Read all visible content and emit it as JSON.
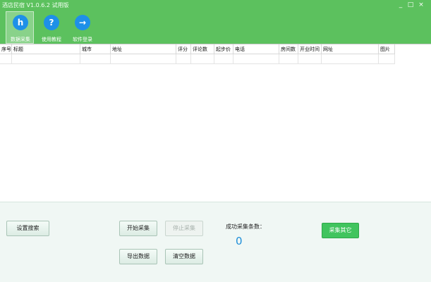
{
  "app": {
    "title": "酒店民宿 V1.0.6.2 试用版",
    "window_controls": {
      "minimize": "_",
      "maximize": "□",
      "close": "×"
    }
  },
  "toolbar": {
    "items": [
      {
        "label": "数据采集",
        "icon": "h",
        "icon_name": "h-logo-icon",
        "active": true
      },
      {
        "label": "使用教程",
        "icon": "?",
        "icon_name": "question-icon",
        "active": false
      },
      {
        "label": "软件登录",
        "icon": "→",
        "icon_name": "arrow-right-icon",
        "active": false
      }
    ]
  },
  "table": {
    "columns": [
      "序号",
      "标题",
      "城市",
      "地址",
      "评分",
      "评论数",
      "起步价",
      "电话",
      "房间数",
      "开业时间",
      "网址",
      "图片"
    ],
    "rows": []
  },
  "controls": {
    "settings_label": "设置搜索",
    "start_label": "开始采集",
    "stop_label": "停止采集",
    "export_label": "导出数据",
    "clear_label": "清空数据",
    "other_label": "采集其它",
    "count_label": "成功采集条数：",
    "count_value": "0"
  },
  "colors": {
    "titlebar": "#5cc15e",
    "icon_blue": "#1e90e8",
    "accent_green": "#41c45e",
    "count_blue": "#1e8ed8"
  }
}
